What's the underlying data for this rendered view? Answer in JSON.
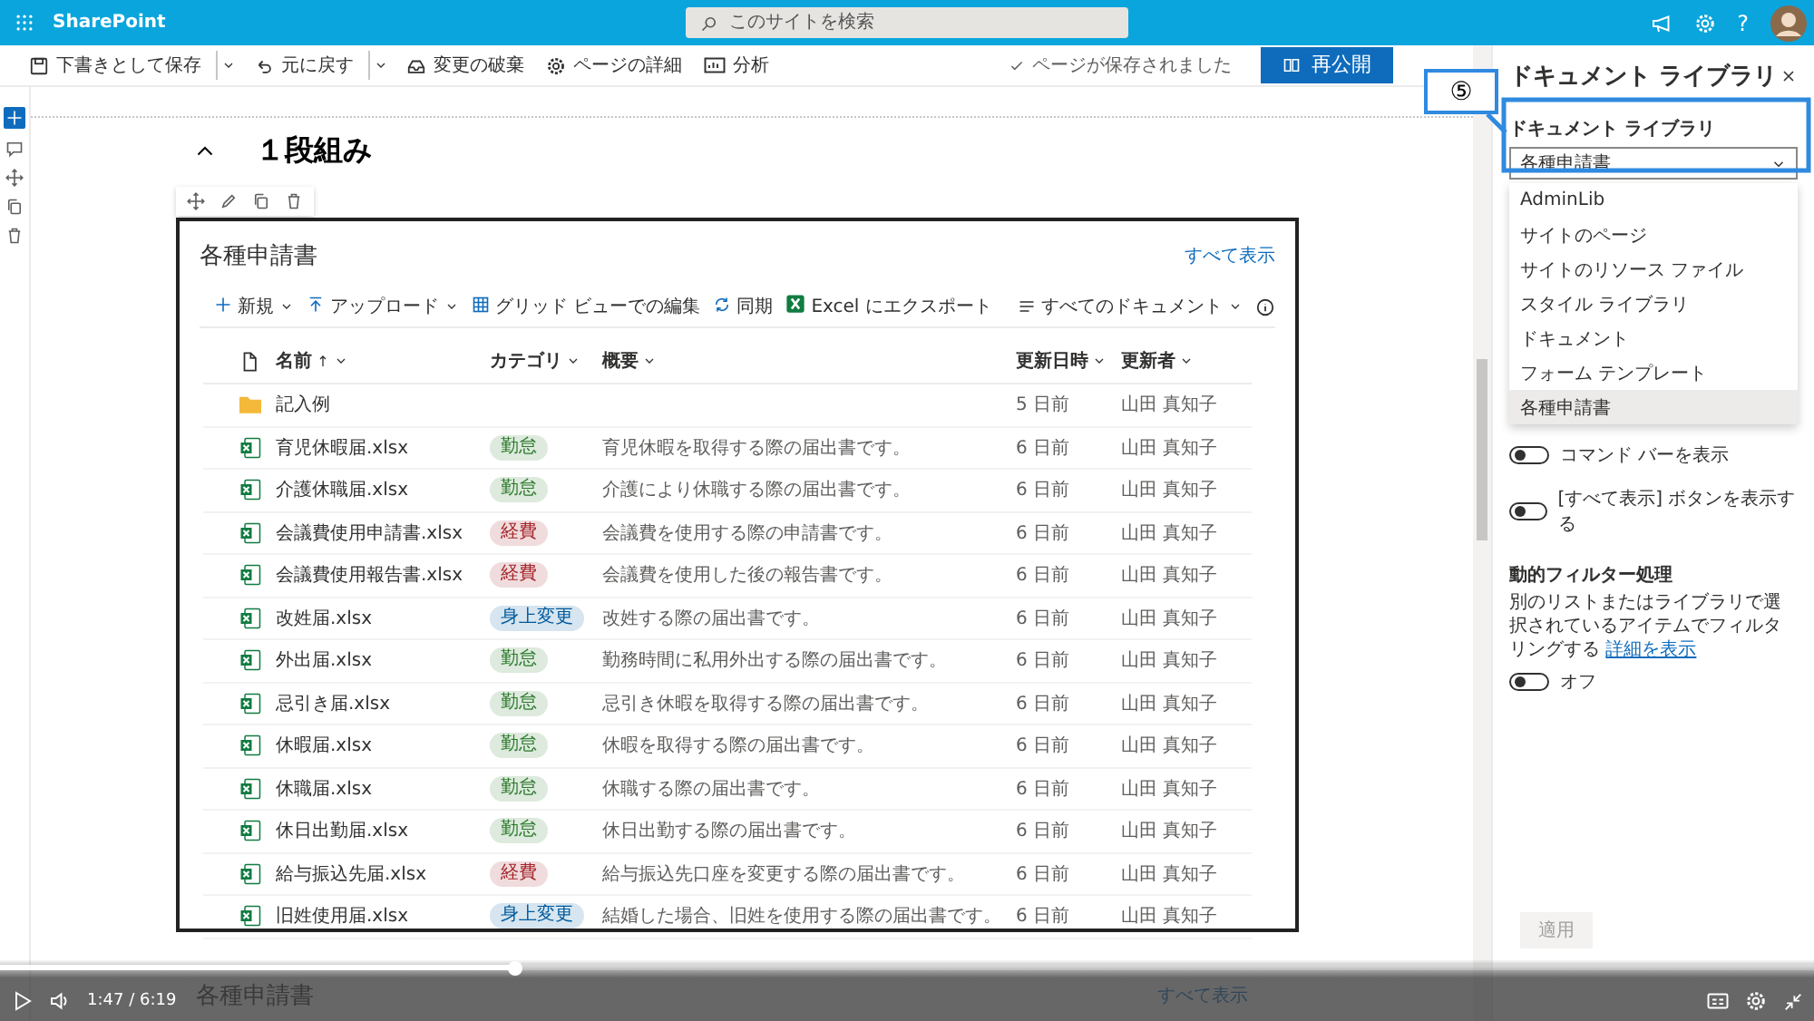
{
  "app_bar": {
    "app_name": "SharePoint",
    "search": {
      "placeholder": "このサイトを検索"
    },
    "help_label": "?"
  },
  "command_bar": {
    "items": [
      {
        "kind": "button",
        "label": "下書きとして保存"
      },
      {
        "kind": "split"
      },
      {
        "kind": "button",
        "label": "元に戻す"
      },
      {
        "kind": "split"
      },
      {
        "kind": "button",
        "label": "変更の破棄"
      },
      {
        "kind": "button",
        "label": "ページの詳細"
      },
      {
        "kind": "button",
        "label": "分析"
      }
    ],
    "status": "ページが保存されました",
    "publish_button": "再公開"
  },
  "section": {
    "title": "１段組み",
    "expanded": true
  },
  "web_part": {
    "title": "各種申請書",
    "see_all": "すべて表示",
    "toolbar": [
      {
        "label": "新規",
        "dropdown": true
      },
      {
        "label": "アップロード",
        "dropdown": true
      },
      {
        "label": "グリッド ビューでの編集",
        "dropdown": false
      },
      {
        "label": "同期",
        "dropdown": false
      },
      {
        "label": "Excel にエクスポート",
        "dropdown": false
      }
    ],
    "view": "すべてのドキュメント",
    "columns": [
      {
        "label": "名前",
        "sorted": true
      },
      {
        "label": "カテゴリ",
        "sorted": false
      },
      {
        "label": "概要",
        "sorted": false
      },
      {
        "label": "更新日時",
        "sorted": false
      },
      {
        "label": "更新者",
        "sorted": false
      }
    ],
    "rows": [
      {
        "kind": "folder",
        "name": "記入例",
        "modified": "5 日前",
        "modified_by": "山田 真知子"
      },
      {
        "kind": "file",
        "name": "育児休暇届.xlsx",
        "category": {
          "label": "勤怠",
          "color": "#2b7a2b"
        },
        "description": "育児休暇を取得する際の届出書です。",
        "modified": "6 日前",
        "modified_by": "山田 真知子"
      },
      {
        "kind": "file",
        "name": "介護休職届.xlsx",
        "category": {
          "label": "勤怠",
          "color": "#2b7a2b"
        },
        "description": "介護により休職する際の届出書です。",
        "modified": "6 日前",
        "modified_by": "山田 真知子"
      },
      {
        "kind": "file",
        "name": "会議費使用申請書.xlsx",
        "category": {
          "label": "経費",
          "color": "#a4262c"
        },
        "description": "会議費を使用する際の申請書です。",
        "modified": "6 日前",
        "modified_by": "山田 真知子"
      },
      {
        "kind": "file",
        "name": "会議費使用報告書.xlsx",
        "category": {
          "label": "経費",
          "color": "#a4262c"
        },
        "description": "会議費を使用した後の報告書です。",
        "modified": "6 日前",
        "modified_by": "山田 真知子"
      },
      {
        "kind": "file",
        "name": "改姓届.xlsx",
        "category": {
          "label": "身上変更",
          "color": "#005a9e"
        },
        "description": "改姓する際の届出書です。",
        "modified": "6 日前",
        "modified_by": "山田 真知子"
      },
      {
        "kind": "file",
        "name": "外出届.xlsx",
        "category": {
          "label": "勤怠",
          "color": "#2b7a2b"
        },
        "description": "勤務時間に私用外出する際の届出書です。",
        "modified": "6 日前",
        "modified_by": "山田 真知子"
      },
      {
        "kind": "file",
        "name": "忌引き届.xlsx",
        "category": {
          "label": "勤怠",
          "color": "#2b7a2b"
        },
        "description": "忌引き休暇を取得する際の届出書です。",
        "modified": "6 日前",
        "modified_by": "山田 真知子"
      },
      {
        "kind": "file",
        "name": "休暇届.xlsx",
        "category": {
          "label": "勤怠",
          "color": "#2b7a2b"
        },
        "description": "休暇を取得する際の届出書です。",
        "modified": "6 日前",
        "modified_by": "山田 真知子"
      },
      {
        "kind": "file",
        "name": "休職届.xlsx",
        "category": {
          "label": "勤怠",
          "color": "#2b7a2b"
        },
        "description": "休職する際の届出書です。",
        "modified": "6 日前",
        "modified_by": "山田 真知子"
      },
      {
        "kind": "file",
        "name": "休日出勤届.xlsx",
        "category": {
          "label": "勤怠",
          "color": "#2b7a2b"
        },
        "description": "休日出勤する際の届出書です。",
        "modified": "6 日前",
        "modified_by": "山田 真知子"
      },
      {
        "kind": "file",
        "name": "給与振込先届.xlsx",
        "category": {
          "label": "経費",
          "color": "#a4262c"
        },
        "description": "給与振込先口座を変更する際の届出書です。",
        "modified": "6 日前",
        "modified_by": "山田 真知子"
      },
      {
        "kind": "file",
        "name": "旧姓使用届.xlsx",
        "category": {
          "label": "身上変更",
          "color": "#005a9e"
        },
        "description": "結婚した場合、旧姓を使用する際の届出書です。",
        "modified": "6 日前",
        "modified_by": "山田 真知子"
      }
    ]
  },
  "next_section": {
    "title": "各種申請書",
    "see_all": "すべて表示"
  },
  "panel": {
    "title": "ドキュメント ライブラリ",
    "library_field": {
      "label": "ドキュメント ライブラリ",
      "value": "各種申請書",
      "options": [
        {
          "label": "AdminLib",
          "selected": false
        },
        {
          "label": "サイトのページ",
          "selected": false
        },
        {
          "label": "サイトのリソース ファイル",
          "selected": false
        },
        {
          "label": "スタイル ライブラリ",
          "selected": false
        },
        {
          "label": "ドキュメント",
          "selected": false
        },
        {
          "label": "フォーム テンプレート",
          "selected": false
        },
        {
          "label": "各種申請書",
          "selected": true
        }
      ]
    },
    "toggles": [
      {
        "label": "コマンド バーを表示",
        "on": false
      },
      {
        "label": "[すべて表示] ボタンを表示する",
        "on": false
      }
    ],
    "dynamic_filter": {
      "title": "動的フィルター処理",
      "description": "別のリストまたはライブラリで選択されているアイテムでフィルタリングする",
      "link": "詳細を表示",
      "toggle": {
        "label": "オフ",
        "on": false
      }
    },
    "apply_button": {
      "label": "適用",
      "disabled": true
    }
  },
  "callout": {
    "label": "⑤"
  },
  "player": {
    "time": "1:47 / 6:19",
    "level": 0.284,
    "playing": false
  }
}
